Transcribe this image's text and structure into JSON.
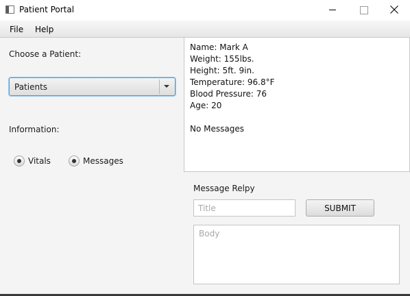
{
  "window": {
    "title": "Patient Portal",
    "icon": "app-window-icon",
    "controls": [
      "minimize-icon",
      "maximize-icon",
      "close-icon"
    ]
  },
  "menu": {
    "file": "File",
    "help": "Help"
  },
  "patient_select": {
    "label": "Choose a Patient:",
    "selected": "Patients"
  },
  "information": {
    "label": "Information:",
    "options": {
      "vitals": "Vitals",
      "messages": "Messages"
    }
  },
  "details": {
    "name": "Name: Mark A",
    "weight": "Weight: 155lbs.",
    "height": "Height: 5ft. 9in.",
    "temperature": "Temperature: 96.8°F",
    "blood_pressure": "Blood Pressure: 76",
    "age": "Age: 20",
    "messages_status": "No Messages"
  },
  "reply": {
    "label": "Message Relpy",
    "title_placeholder": "Title",
    "title_value": "",
    "submit_label": "SUBMIT",
    "body_placeholder": "Body",
    "body_value": ""
  },
  "colors": {
    "focus_border": "#4b9fd8",
    "background": "#f4f4f4",
    "panel": "#ffffff"
  }
}
